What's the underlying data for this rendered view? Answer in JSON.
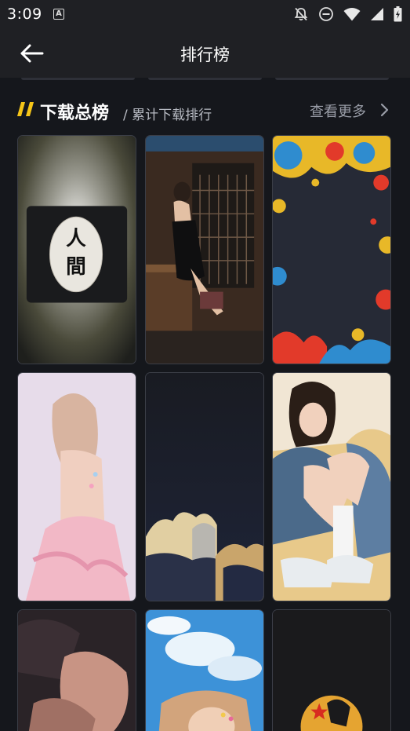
{
  "status_bar": {
    "time": "3:09",
    "notification_icon": "A",
    "icons": [
      "bell-off-icon",
      "do-not-disturb-icon",
      "wifi-icon",
      "signal-icon",
      "battery-charging-icon"
    ]
  },
  "app_bar": {
    "back_icon": "arrow-left-icon",
    "title": "排行榜"
  },
  "section": {
    "accent_color": "#f5c518",
    "title": "下载总榜",
    "subtitle": "/ 累计下载排行",
    "more_label": "查看更多",
    "more_icon": "chevron-right-icon"
  },
  "wallpapers": [
    {
      "row": 1,
      "col": 1,
      "subject": "lantern-wallpaper"
    },
    {
      "row": 1,
      "col": 2,
      "subject": "bar-interior-photo"
    },
    {
      "row": 1,
      "col": 3,
      "subject": "paint-splatter-frame"
    },
    {
      "row": 2,
      "col": 1,
      "subject": "pink-dress-portrait"
    },
    {
      "row": 2,
      "col": 2,
      "subject": "dark-clouds-art"
    },
    {
      "row": 2,
      "col": 3,
      "subject": "denim-jacket-portrait"
    },
    {
      "row": 3,
      "col": 1,
      "subject": "dark-portrait"
    },
    {
      "row": 3,
      "col": 2,
      "subject": "sky-portrait"
    },
    {
      "row": 3,
      "col": 3,
      "subject": "dragon-ball-emblem"
    }
  ]
}
